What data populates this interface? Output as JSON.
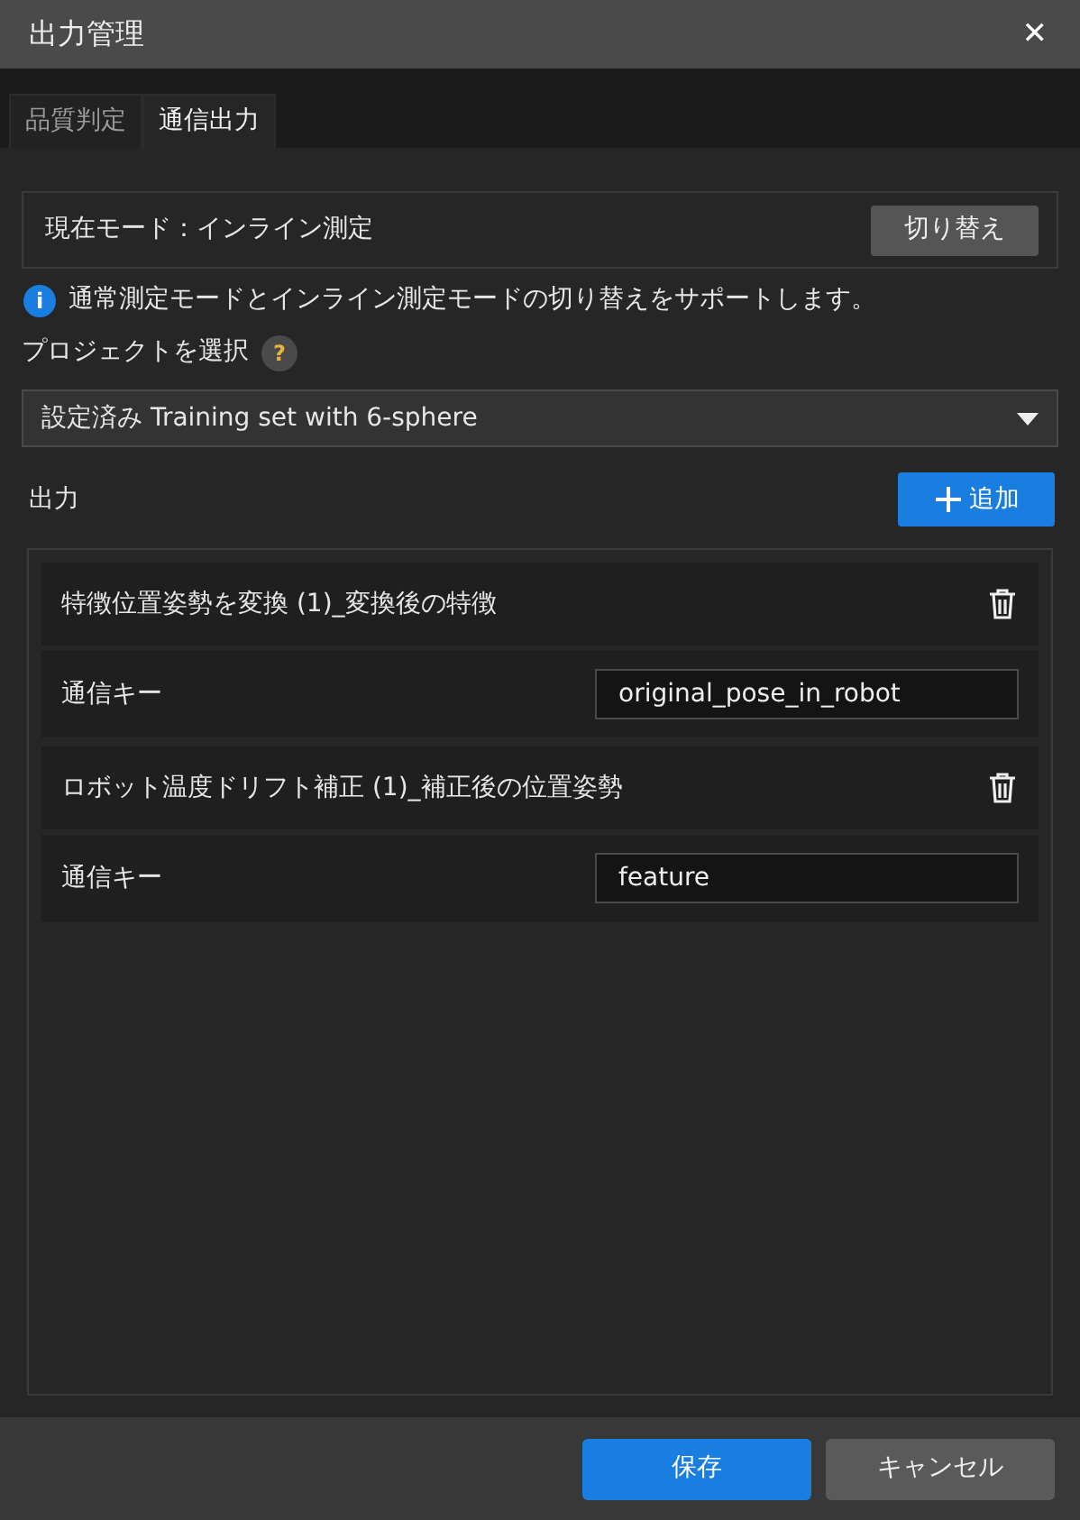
{
  "window": {
    "title": "出力管理",
    "close_glyph": "✕"
  },
  "tabs": [
    {
      "label": "品質判定",
      "selected": false
    },
    {
      "label": "通信出力",
      "selected": true
    }
  ],
  "mode": {
    "label": "現在モード：インライン測定",
    "button": "切り替え"
  },
  "info": {
    "icon_glyph": "i",
    "text": "通常測定モードとインライン測定モードの切り替えをサポートします。"
  },
  "project": {
    "label": "プロジェクトを選択",
    "help_glyph": "?",
    "value": "設定済み Training set with 6-sphere"
  },
  "outputs": {
    "label": "出力",
    "add_button": "追加",
    "items": [
      {
        "title": "特徴位置姿勢を変換 (1)_変換後の特徴",
        "key_label": "通信キー",
        "key_value": "original_pose_in_robot"
      },
      {
        "title": "ロボット温度ドリフト補正 (1)_補正後の位置姿勢",
        "key_label": "通信キー",
        "key_value": "feature"
      }
    ]
  },
  "footer": {
    "buttons": [
      {
        "label": "保存",
        "kind": "primary"
      },
      {
        "label": "キャンセル",
        "kind": "secondary"
      }
    ]
  }
}
